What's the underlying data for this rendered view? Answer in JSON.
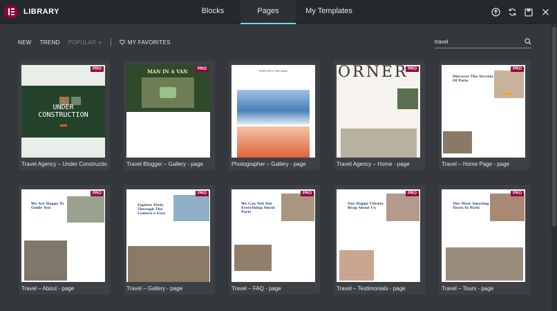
{
  "header": {
    "brand": "LIBRARY",
    "tabs": [
      {
        "label": "Blocks"
      },
      {
        "label": "Pages"
      },
      {
        "label": "My Templates"
      }
    ],
    "accent": "#71d7f7",
    "logo_color": "#92003b"
  },
  "filters": {
    "new": "NEW",
    "trend": "TREND",
    "popular": "POPULAR",
    "favorites": "MY FAVORITES"
  },
  "search": {
    "value": "travel"
  },
  "badge": "PRO",
  "cards": [
    {
      "title": "Travel Agency – Under Construction - page",
      "thumb_text": "UNDER CONSTRUCTION"
    },
    {
      "title": "Travel Blogger – Gallery - page",
      "thumb_text": "MAN IN A VAN"
    },
    {
      "title": "Photographer – Gallery - page",
      "thumb_text": "STEP INTO THE WILD"
    },
    {
      "title": "Travel Agency – Home - page",
      "thumb_text": "ORNER"
    },
    {
      "title": "Travel – Home Page - page",
      "thumb_text": "Discover The Secrets Of Paris"
    },
    {
      "title": "Travel – About - page",
      "thumb_text": "We Are Happy To Guide You"
    },
    {
      "title": "Travel – Gallery - page",
      "thumb_text": "Explore Paris Through The Camera's Eyes"
    },
    {
      "title": "Travel – FAQ - page",
      "thumb_text": "We Can Tell You Everything About Paris"
    },
    {
      "title": "Travel – Testimonials - page",
      "thumb_text": "Our Happy Clients Brag About Us"
    },
    {
      "title": "Travel – Tours - page",
      "thumb_text": "The Most Amazing Tours In Paris"
    }
  ]
}
